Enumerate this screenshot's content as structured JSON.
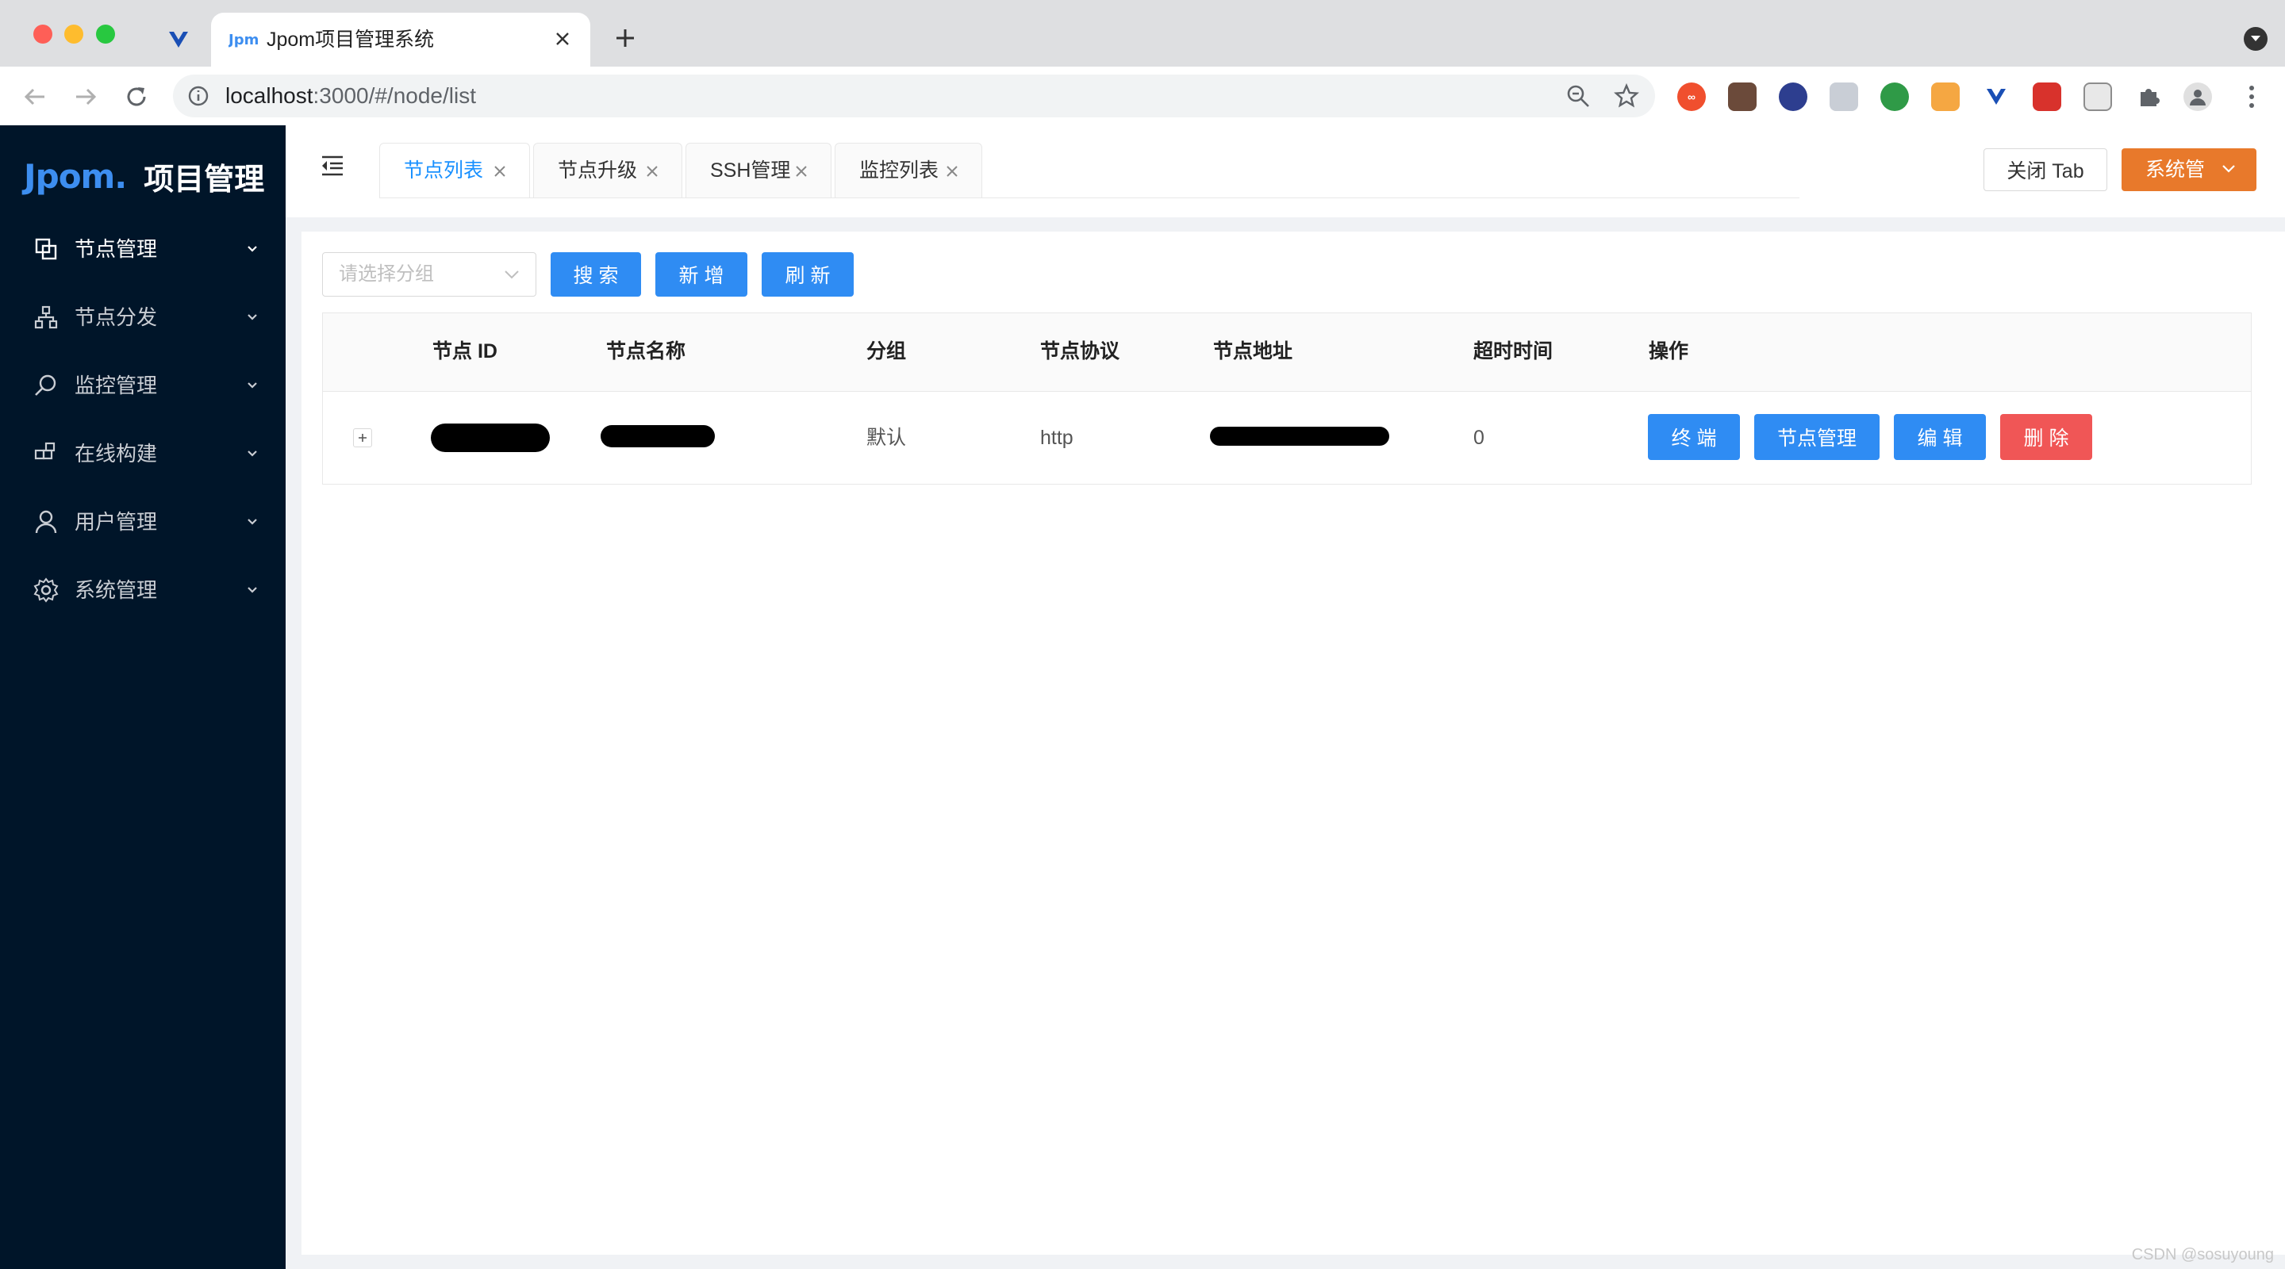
{
  "browser": {
    "tab_title": "Jpom项目管理系统",
    "url_host": "localhost",
    "url_rest": ":3000/#/node/list"
  },
  "app": {
    "logo_mark": "Jpom.",
    "logo_name": "项目管理"
  },
  "sidebar": {
    "items": [
      {
        "label": "节点管理",
        "icon": "nodes-icon"
      },
      {
        "label": "节点分发",
        "icon": "distribute-icon"
      },
      {
        "label": "监控管理",
        "icon": "monitor-icon"
      },
      {
        "label": "在线构建",
        "icon": "build-icon"
      },
      {
        "label": "用户管理",
        "icon": "user-icon"
      },
      {
        "label": "系统管理",
        "icon": "gear-icon"
      }
    ]
  },
  "page_tabs": [
    {
      "label": "节点列表",
      "active": true
    },
    {
      "label": "节点升级",
      "active": false
    },
    {
      "label": "SSH管理",
      "active": false
    },
    {
      "label": "监控列表",
      "active": false
    }
  ],
  "header": {
    "close_tab_label": "关闭 Tab",
    "system_label": "系统管"
  },
  "filters": {
    "group_placeholder": "请选择分组",
    "search_label": "搜 索",
    "add_label": "新 增",
    "refresh_label": "刷 新"
  },
  "table": {
    "columns": [
      "节点 ID",
      "节点名称",
      "分组",
      "节点协议",
      "节点地址",
      "超时时间",
      "操作"
    ],
    "rows": [
      {
        "group": "默认",
        "protocol": "http",
        "timeout": "0",
        "actions": {
          "terminal": "终 端",
          "manage": "节点管理",
          "edit": "编 辑",
          "delete": "删 除"
        }
      }
    ]
  },
  "watermark": "CSDN @sosuyoung",
  "colors": {
    "sidebar_bg": "#001529",
    "primary": "#2f8cf3",
    "danger": "#f05656",
    "system_btn": "#e8792b"
  }
}
